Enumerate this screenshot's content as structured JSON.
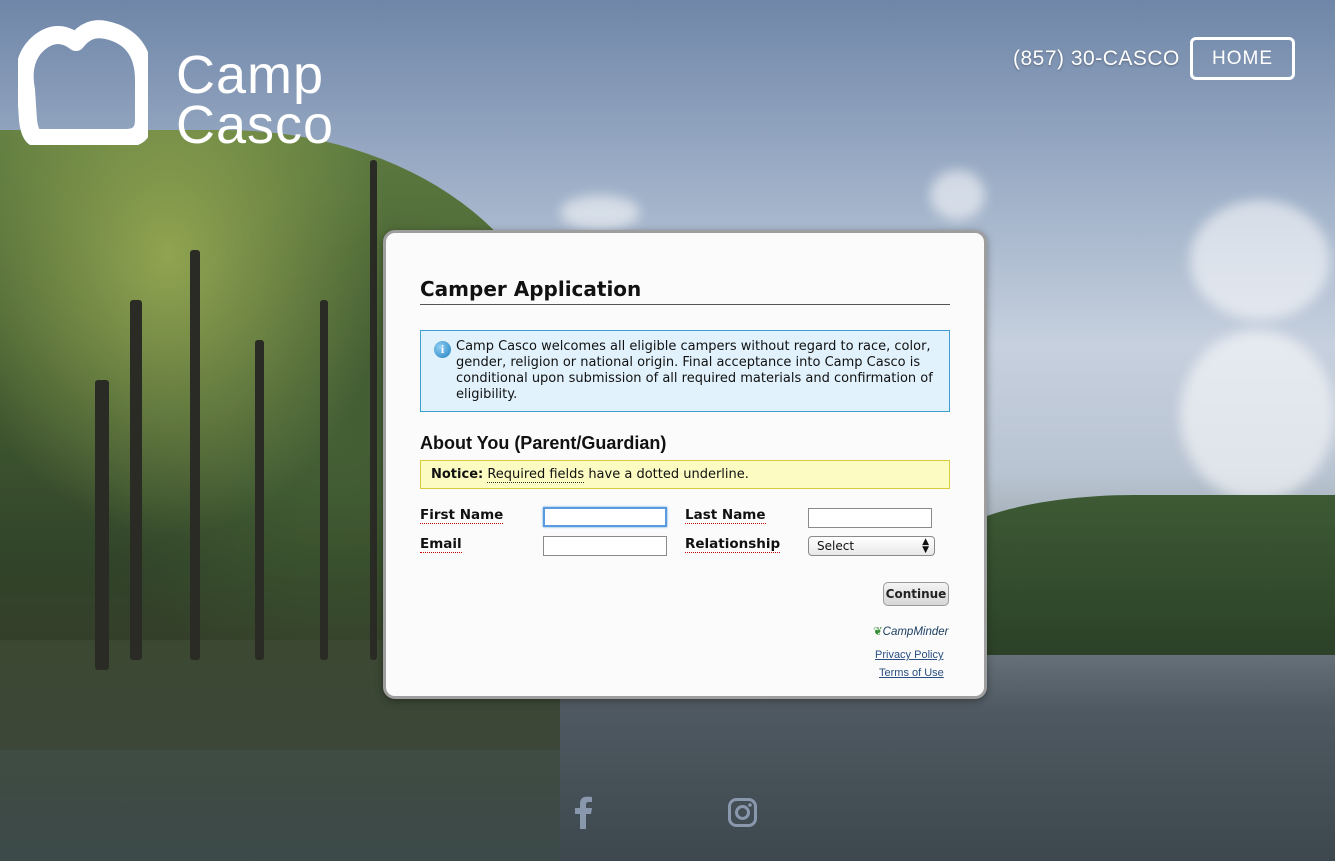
{
  "brand": {
    "line1": "Camp",
    "line2": "Casco"
  },
  "header": {
    "phone": "(857) 30-CASCO",
    "home_label": "HOME"
  },
  "form": {
    "title": "Camper Application",
    "info_text": "Camp Casco welcomes all eligible campers without regard to race, color, gender, religion or national origin. Final acceptance into Camp Casco is conditional upon submission of all required materials and confirmation of eligibility.",
    "section_title": "About You (Parent/Guardian)",
    "notice": {
      "label": "Notice:",
      "link": "Required fields",
      "rest": "have a dotted underline."
    },
    "fields": {
      "first_name_label": "First Name",
      "first_name_value": "",
      "last_name_label": "Last Name",
      "last_name_value": "",
      "email_label": "Email",
      "email_value": "",
      "relationship_label": "Relationship",
      "relationship_value": "Select"
    },
    "continue_label": "Continue",
    "powered_by": "CampMinder",
    "privacy_label": "Privacy Policy",
    "terms_label": "Terms of Use"
  },
  "social": {
    "icons": [
      "facebook-icon",
      "instagram-icon"
    ]
  }
}
